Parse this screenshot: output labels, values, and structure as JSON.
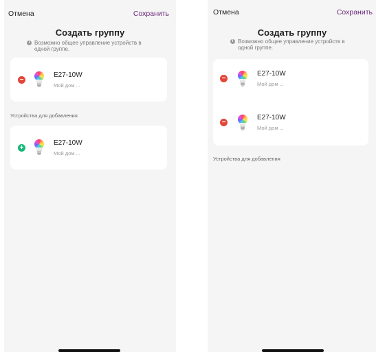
{
  "left": {
    "header": {
      "cancel_label": "Отмена",
      "save_label": "Сохранить"
    },
    "title": "Создать группу",
    "hint": {
      "line1": "Возможно общее управление устройств в",
      "line2": "одной группе."
    },
    "group_devices": [
      {
        "name": "E27-10W",
        "room": "Мой дом ...",
        "action": "remove"
      }
    ],
    "section_label": "Устройства для добавления",
    "available_devices": [
      {
        "name": "E27-10W",
        "room": "Мой дом ...",
        "action": "add"
      }
    ]
  },
  "right": {
    "header": {
      "cancel_label": "Отмена",
      "save_label": "Сохранить"
    },
    "title": "Создать группу",
    "hint": {
      "line1": "Возможно общее управление устройств в",
      "line2": "одной группе."
    },
    "group_devices": [
      {
        "name": "E27-10W",
        "room": "Мой дом ...",
        "action": "remove"
      },
      {
        "name": "E27-10W",
        "room": "Мой дом ...",
        "action": "remove"
      }
    ],
    "section_label": "Устройства для добавления",
    "available_devices": []
  },
  "icons": {
    "remove": "minus-circle-icon",
    "add": "plus-circle-icon",
    "device": "rgb-bulb-icon",
    "hint": "info-icon"
  },
  "colors": {
    "save": "#6b2a7a",
    "remove": "#e2463a",
    "add": "#17b877",
    "background": "#f5f5f5",
    "card": "#ffffff"
  }
}
